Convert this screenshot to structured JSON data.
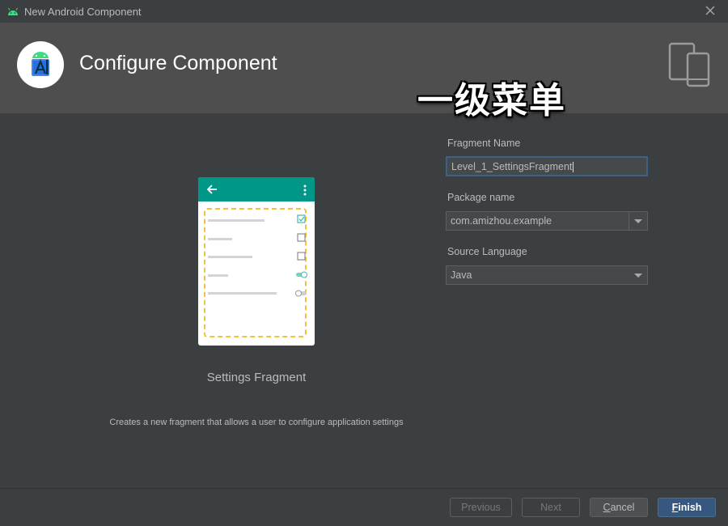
{
  "window": {
    "title": "New Android Component"
  },
  "header": {
    "title": "Configure Component",
    "overlay_text": "一级菜单"
  },
  "preview": {
    "name": "Settings Fragment",
    "description": "Creates a new fragment that allows a user to configure application settings"
  },
  "form": {
    "fragment_name": {
      "label": "Fragment Name",
      "value": "Level_1_SettingsFragment"
    },
    "package_name": {
      "label": "Package name",
      "value": "com.amizhou.example"
    },
    "source_language": {
      "label": "Source Language",
      "value": "Java"
    }
  },
  "footer": {
    "previous": {
      "mnemonic": "",
      "rest": "Previous"
    },
    "next": {
      "mnemonic": "",
      "rest": "Next"
    },
    "cancel": {
      "mnemonic": "C",
      "rest": "ancel"
    },
    "finish": {
      "mnemonic": "F",
      "rest": "inish"
    }
  },
  "colors": {
    "accent": "#009688",
    "dash": "#f0c33c",
    "primary_button": "#365880",
    "focus_border": "#3d6185"
  },
  "icons": [
    "android-icon",
    "close-icon",
    "android-studio-logo-icon",
    "devices-icon",
    "back-arrow-icon",
    "more-vert-icon",
    "checkbox-icon",
    "toggle-icon",
    "dropdown-arrow-icon"
  ]
}
